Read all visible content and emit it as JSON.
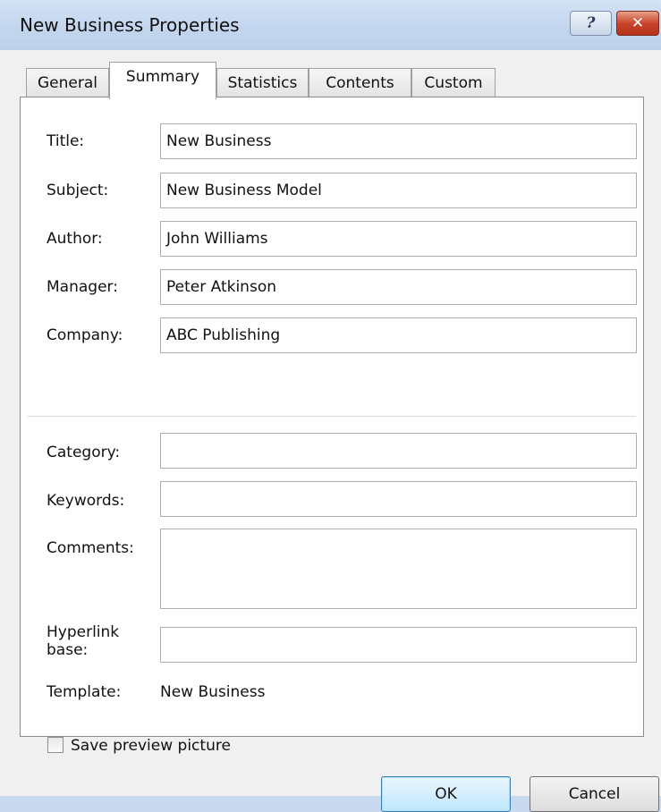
{
  "window": {
    "title": "New Business Properties",
    "help_glyph": "?",
    "close_glyph": "✕"
  },
  "tabs": [
    {
      "label": "General"
    },
    {
      "label": "Summary",
      "active": true
    },
    {
      "label": "Statistics"
    },
    {
      "label": "Contents"
    },
    {
      "label": "Custom"
    }
  ],
  "summary": {
    "fields": [
      {
        "label": "Title:",
        "value": "New Business"
      },
      {
        "label": "Subject:",
        "value": "New Business Model"
      },
      {
        "label": "Author:",
        "value": "John Williams"
      },
      {
        "label": "Manager:",
        "value": "Peter Atkinson"
      },
      {
        "label": "Company:",
        "value": "ABC Publishing"
      },
      {
        "label": "Category:",
        "value": ""
      },
      {
        "label": "Keywords:",
        "value": ""
      },
      {
        "label": "Comments:",
        "value": ""
      },
      {
        "label": "Hyperlink\nbase:",
        "value": ""
      }
    ],
    "template_label": "Template:",
    "template_value": "New Business",
    "save_preview_label": "Save preview picture",
    "save_preview_checked": false
  },
  "buttons": {
    "ok": "OK",
    "cancel": "Cancel"
  }
}
